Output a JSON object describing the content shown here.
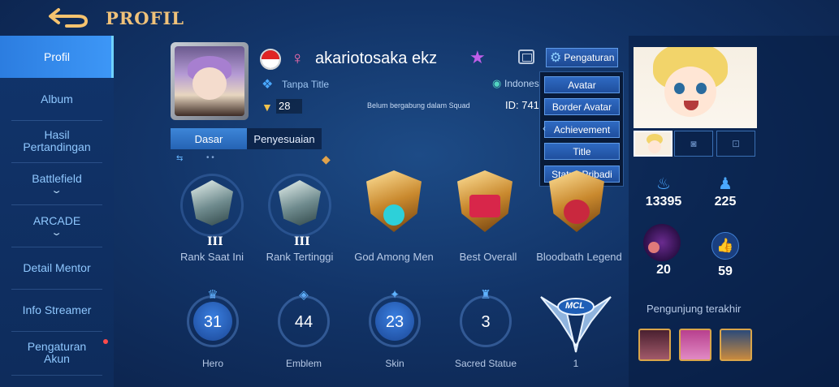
{
  "header": {
    "title": "PROFIL",
    "back_icon": "back-arrow-icon"
  },
  "sidebar": {
    "items": [
      {
        "label": "Profil",
        "active": true
      },
      {
        "label": "Album"
      },
      {
        "label": "Hasil Pertandingan"
      },
      {
        "label": "Battlefield",
        "expand": true
      },
      {
        "label": "ARCADE",
        "expand": true
      },
      {
        "label": "Detail Mentor"
      },
      {
        "label": "Info Streamer"
      },
      {
        "label": "Pengaturan Akun",
        "notification_dot": true
      }
    ]
  },
  "profile": {
    "flag": "Indonesia",
    "gender_symbol": "♀",
    "name": "akariotosaka ekz",
    "title": "Tanpa Title",
    "level": "28",
    "squad": "Belum bergabung dalam Squad",
    "location": "Indones",
    "id": "ID: 741",
    "settings_label": "Pengaturan"
  },
  "dropdown": {
    "items": [
      "Avatar",
      "Border Avatar",
      "Achievement",
      "Title",
      "Status Pribadi"
    ]
  },
  "tabs": [
    {
      "label": "Dasar",
      "active": true
    },
    {
      "label": "Penyesuaian",
      "active": false
    }
  ],
  "ranks": [
    {
      "tier": "III",
      "label": "Rank Saat Ini"
    },
    {
      "tier": "III",
      "label": "Rank Tertinggi"
    },
    {
      "label": "God Among Men"
    },
    {
      "label": "Best Overall"
    },
    {
      "label": "Bloodbath Legend"
    }
  ],
  "stats": [
    {
      "value": "31",
      "label": "Hero"
    },
    {
      "value": "44",
      "label": "Emblem"
    },
    {
      "value": "23",
      "label": "Skin"
    },
    {
      "value": "3",
      "label": "Sacred Statue"
    },
    {
      "value": "1",
      "label": "",
      "badge_text": "MCL"
    }
  ],
  "right_panel": {
    "popularity": "13395",
    "followers": "225",
    "charm": "20",
    "likes": "59",
    "recent_visitors_label": "Pengunjung terakhir"
  },
  "colors": {
    "accent": "#3d97f7",
    "title_gold": "#f0c27a",
    "sidebar_text": "#8fc8ff"
  }
}
